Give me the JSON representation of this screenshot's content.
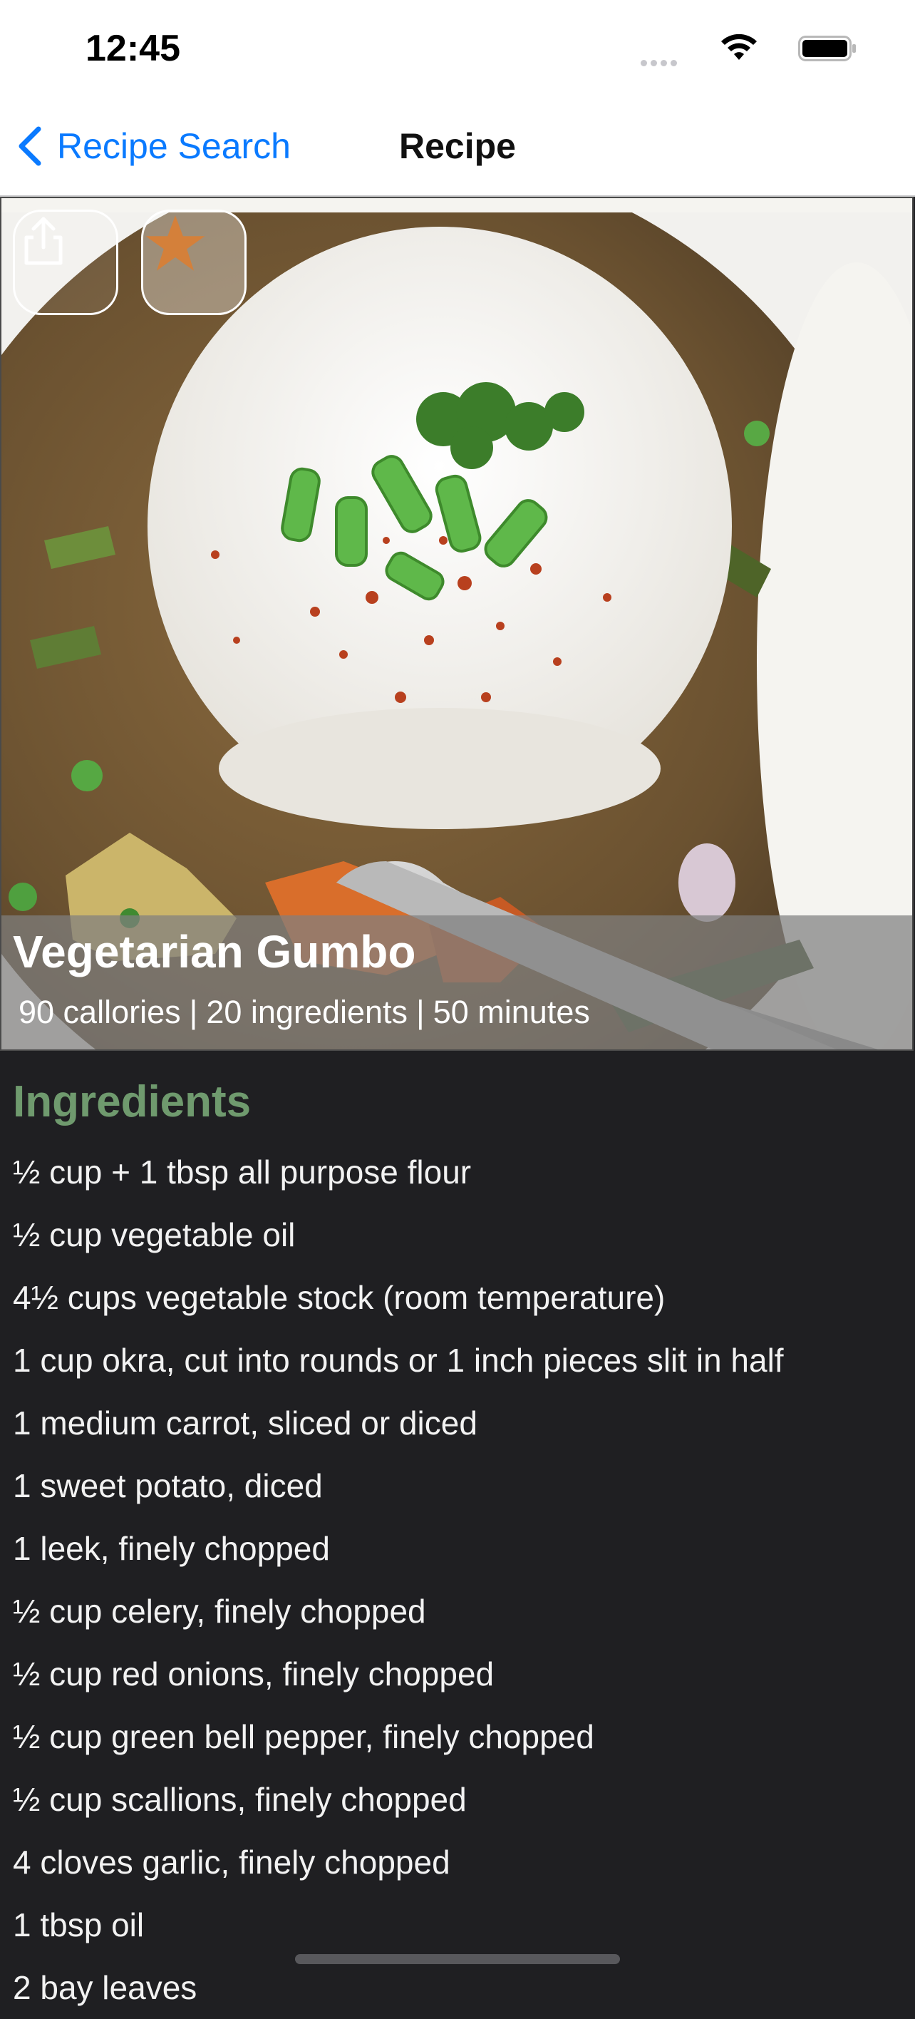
{
  "status_bar": {
    "time": "12:45"
  },
  "nav": {
    "back_label": "Recipe Search",
    "title": "Recipe"
  },
  "recipe": {
    "title": "Vegetarian Gumbo",
    "calories": "90 callories",
    "ingredients_count": "20 ingredients",
    "duration": "50 minutes",
    "separator": "|"
  },
  "ingredients": {
    "heading": "Ingredients",
    "items": [
      "½ cup + 1 tbsp all purpose flour",
      "½ cup vegetable oil",
      "4½ cups vegetable stock (room temperature)",
      "1 cup okra, cut into rounds or 1 inch pieces slit in half",
      "1 medium carrot, sliced or diced",
      "1 sweet potato, diced",
      "1 leek, finely chopped",
      "½ cup celery, finely chopped",
      "½ cup red onions, finely chopped",
      "½ cup green bell pepper, finely chopped",
      "½ cup scallions, finely chopped",
      "4 cloves garlic, finely chopped",
      "1 tbsp oil",
      "2 bay leaves"
    ]
  },
  "icons": {
    "back": "chevron-left-icon",
    "share": "share-icon",
    "favorite": "star-icon",
    "wifi": "wifi-icon",
    "battery": "battery-icon"
  },
  "colors": {
    "accent": "#0a7aff",
    "heading_green": "#6f9a6e",
    "star_orange": "#d4803a",
    "background": "#1f1f22"
  }
}
